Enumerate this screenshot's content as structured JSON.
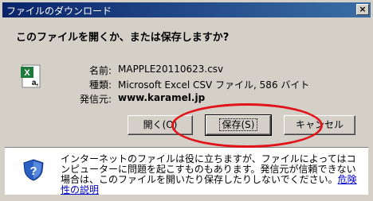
{
  "window": {
    "title": "ファイルのダウンロード",
    "close_label": "×"
  },
  "prompt": {
    "question": "このファイルを開くか、または保存しますか?"
  },
  "file": {
    "icon": "excel-csv-file-icon",
    "name_label": "名前:",
    "name_value": "MAPPLE20110623.csv",
    "type_label": "種類:",
    "type_value": "Microsoft Excel CSV ファイル, 586 バイト",
    "from_label": "発信元:",
    "from_value": "www.karamel.jp"
  },
  "buttons": {
    "open": "開く(O)",
    "save": "保存(S)",
    "cancel": "キャンセル"
  },
  "warning": {
    "icon": "shield-question-icon",
    "text": "インターネットのファイルは役に立ちますが、ファイルによってはコンピューターに問題を起こすものもあります。発信元が信頼できない場合は、このファイルを開いたり保存したりしないでください。",
    "link": "危険性の説明"
  },
  "annotation": {
    "color": "#e0141a"
  },
  "colors": {
    "titlebar_start": "#0a246a",
    "titlebar_end": "#3a6ea5",
    "dialog_bg": "#d4d0c8"
  }
}
